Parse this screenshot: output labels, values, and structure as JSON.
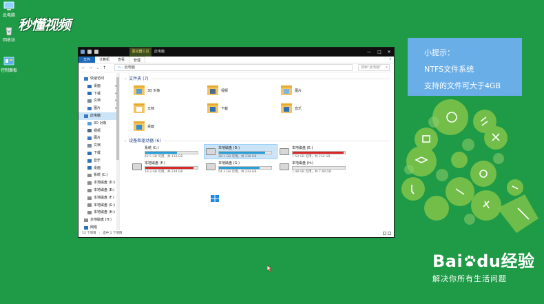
{
  "desktop": {
    "icons": [
      {
        "label": "此电脑"
      },
      {
        "label": "回收站"
      },
      {
        "label": "控制面板"
      }
    ],
    "watermark_logo": "秒懂视频"
  },
  "explorer": {
    "title": "此电脑",
    "context_tab": "驱动器工具",
    "window_buttons": {
      "minimize": "—",
      "maximize": "□",
      "close": "✕"
    },
    "ribbon_tabs": [
      "文件",
      "计算机",
      "查看",
      "管理"
    ],
    "address": "此电脑",
    "search_placeholder": "搜索\"此电脑\"",
    "sidebar": [
      {
        "label": "快速访问",
        "level": 1,
        "icon": "star-icon",
        "pinned": false
      },
      {
        "label": "桌面",
        "level": 2,
        "icon": "desktop-icon",
        "pinned": true
      },
      {
        "label": "下载",
        "level": 2,
        "icon": "download-icon",
        "pinned": true
      },
      {
        "label": "文档",
        "level": 2,
        "icon": "document-icon",
        "pinned": true
      },
      {
        "label": "图片",
        "level": 2,
        "icon": "picture-icon",
        "pinned": true
      },
      {
        "label": "此电脑",
        "level": 1,
        "icon": "computer-icon",
        "pinned": false,
        "selected": true
      },
      {
        "label": "3D 对象",
        "level": 2,
        "icon": "cube-icon",
        "pinned": false
      },
      {
        "label": "视频",
        "level": 2,
        "icon": "video-icon",
        "pinned": false
      },
      {
        "label": "图片",
        "level": 2,
        "icon": "picture-icon",
        "pinned": false
      },
      {
        "label": "文档",
        "level": 2,
        "icon": "document-icon",
        "pinned": false
      },
      {
        "label": "下载",
        "level": 2,
        "icon": "download-icon",
        "pinned": false
      },
      {
        "label": "音乐",
        "level": 2,
        "icon": "music-icon",
        "pinned": false
      },
      {
        "label": "桌面",
        "level": 2,
        "icon": "desktop-icon",
        "pinned": false
      },
      {
        "label": "系统 (C:)",
        "level": 2,
        "icon": "drive-icon",
        "pinned": false
      },
      {
        "label": "本地磁盘 (D:)",
        "level": 2,
        "icon": "drive-icon",
        "pinned": false
      },
      {
        "label": "本地磁盘 (E:)",
        "level": 2,
        "icon": "drive-icon",
        "pinned": false
      },
      {
        "label": "本地磁盘 (F:)",
        "level": 2,
        "icon": "drive-icon",
        "pinned": false
      },
      {
        "label": "本地磁盘 (G:)",
        "level": 2,
        "icon": "drive-icon",
        "pinned": false
      },
      {
        "label": "本地磁盘 (H:)",
        "level": 2,
        "icon": "drive-icon",
        "pinned": false
      },
      {
        "label": "本地磁盘 (H:)",
        "level": 1,
        "icon": "drive-icon",
        "pinned": false
      },
      {
        "label": "网络",
        "level": 1,
        "icon": "network-icon",
        "pinned": false
      }
    ],
    "folders_header": "文件夹 (7)",
    "folders": [
      {
        "label": "3D 对象",
        "badge": "cube"
      },
      {
        "label": "视频",
        "badge": "video"
      },
      {
        "label": "图片",
        "badge": "picture"
      },
      {
        "label": "文档",
        "badge": "document"
      },
      {
        "label": "下载",
        "badge": "download"
      },
      {
        "label": "音乐",
        "badge": "music"
      },
      {
        "label": "桌面",
        "badge": "desktop"
      }
    ],
    "drives_header": "设备和驱动器 (6)",
    "drives": [
      {
        "name": "系统 (C:)",
        "size_text": "42.5 GB 可用，共 110 GB",
        "used_fraction": 0.61,
        "warning": false,
        "is_system": true
      },
      {
        "name": "本地磁盘 (D:)",
        "size_text": "28.1 GB 可用，共 230 GB",
        "used_fraction": 0.88,
        "warning": false,
        "selected": true
      },
      {
        "name": "本地磁盘 (E:)",
        "size_text": "7.50 GB 可用，共 234 GB",
        "used_fraction": 0.97,
        "warning": true
      },
      {
        "name": "本地磁盘 (F:)",
        "size_text": "19.3 GB 可用，共 234 GB",
        "used_fraction": 0.92,
        "warning": true
      },
      {
        "name": "本地磁盘 (G:)",
        "size_text": "54.3 GB 可用，共 233 GB",
        "used_fraction": 0.77,
        "warning": false
      },
      {
        "name": "本地磁盘 (H:)",
        "size_text": "7.48 GB 可用，共 7.48 GB",
        "used_fraction": 0.0,
        "warning": false
      }
    ],
    "status": {
      "count": "13 个项目",
      "selection": "选中 1 个项目"
    }
  },
  "tip": {
    "title": "小提示：",
    "lines": [
      "NTFS文件系统",
      "支持的文件可大于4GB"
    ]
  },
  "baidu": {
    "brand_bai": "Bai",
    "brand_du": "du",
    "brand_suffix": "经验",
    "slogan": "解决你所有生活问题"
  },
  "colors": {
    "desktop_bg": "#1f9a47",
    "tip_bg": "#6aaee8",
    "bar_normal": "#26a0da",
    "bar_warning": "#da2626",
    "selection": "#cce4f7"
  }
}
